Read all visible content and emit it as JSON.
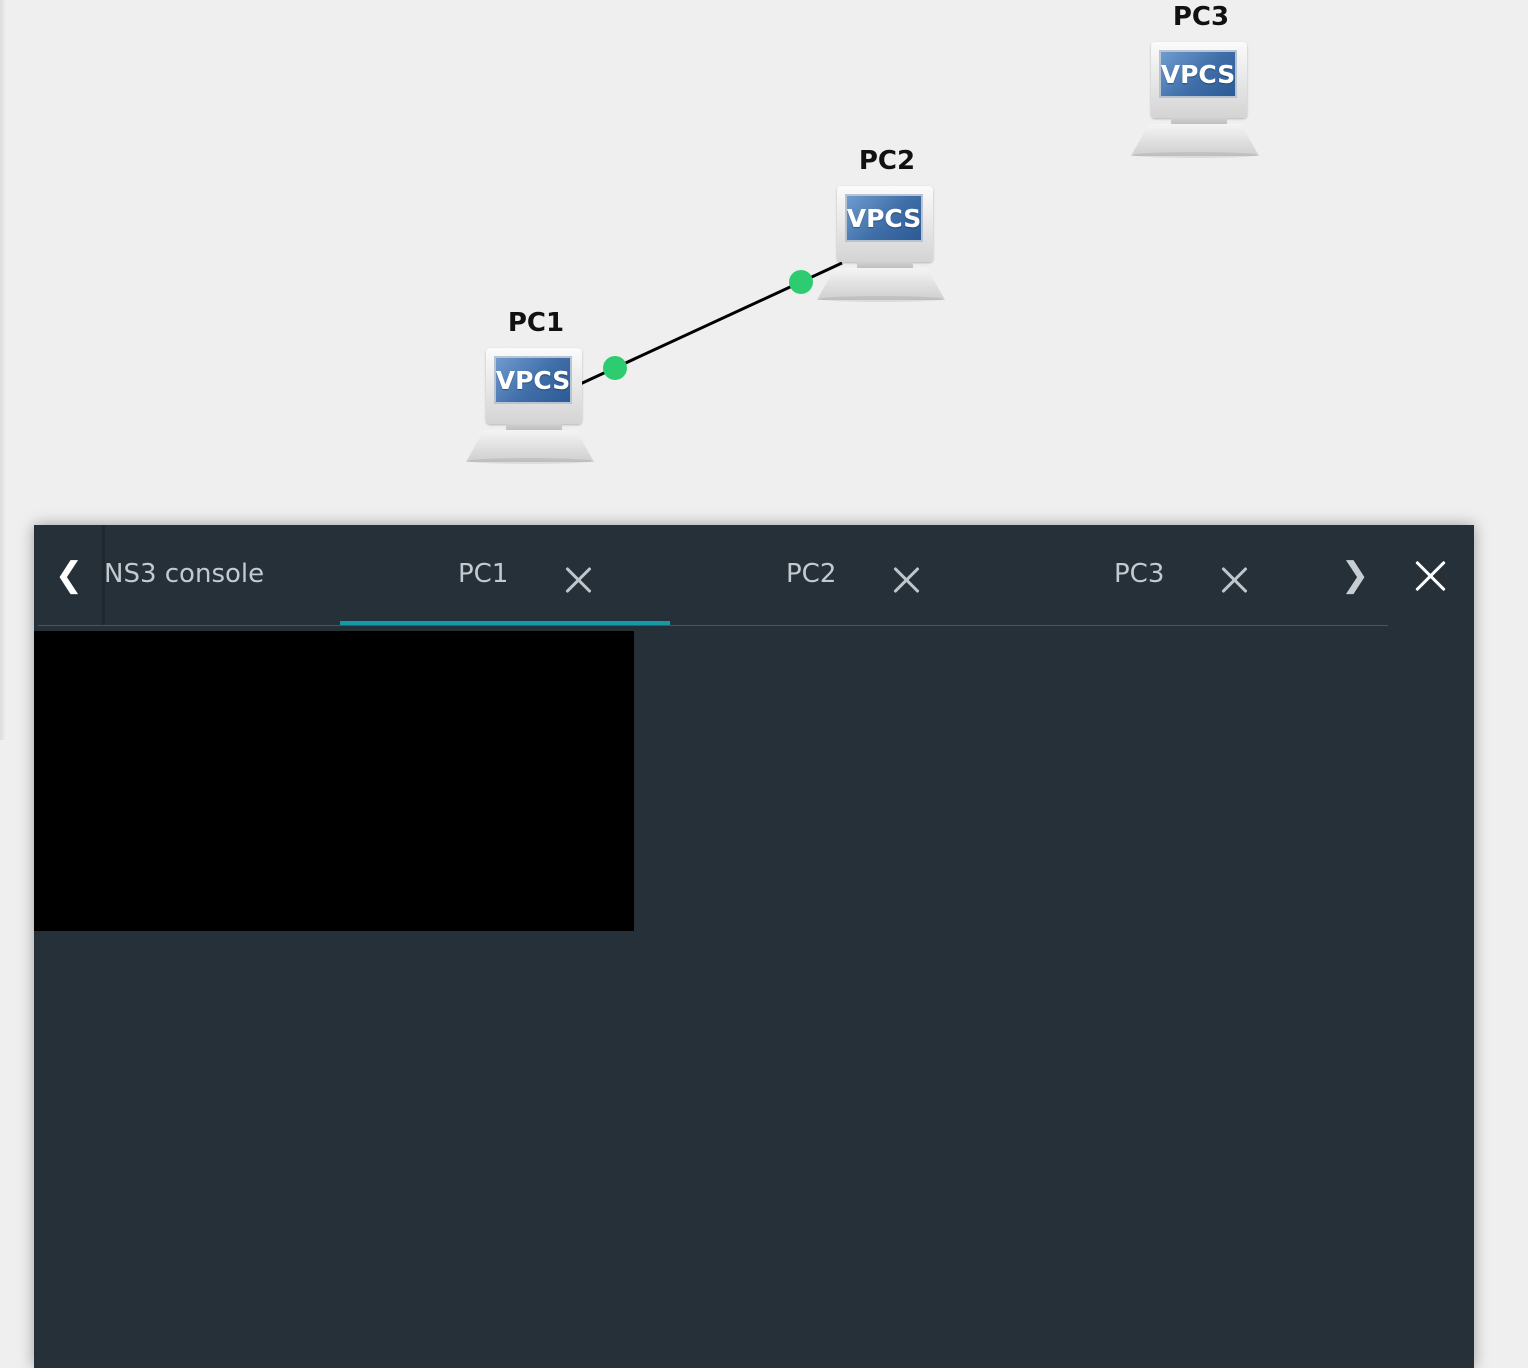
{
  "topology": {
    "nodes": [
      {
        "id": "pc1",
        "label": "PC1",
        "type_text": "VPCS"
      },
      {
        "id": "pc2",
        "label": "PC2",
        "type_text": "VPCS"
      },
      {
        "id": "pc3",
        "label": "PC3",
        "type_text": "VPCS"
      }
    ],
    "links": [
      {
        "from": "PC1",
        "to": "PC2",
        "status": "up",
        "status_color": "#2ecc71",
        "line_color": "#000000"
      }
    ]
  },
  "console": {
    "prev_icon": "chevron-left-icon",
    "next_icon": "chevron-right-icon",
    "close_icon": "close-icon",
    "tabs": [
      {
        "label": "NS3 console",
        "closable": false,
        "active": false
      },
      {
        "label": "PC1",
        "closable": true,
        "active": true
      },
      {
        "label": "PC2",
        "closable": true,
        "active": false
      },
      {
        "label": "PC3",
        "closable": true,
        "active": false
      }
    ],
    "accent_color": "#139aa6",
    "panel_color": "#263039",
    "terminal_color": "#000000"
  }
}
